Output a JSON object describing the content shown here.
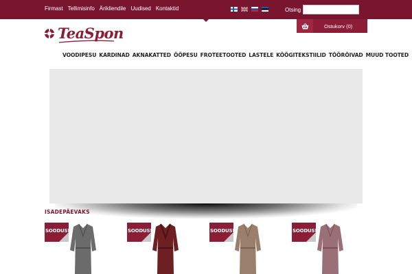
{
  "topbar": {
    "links": [
      "Firmast",
      "Tellimisinfo",
      "Ärikliendile",
      "Uudised",
      "Kontaktid"
    ],
    "languages": [
      {
        "name": "finnish-flag-icon",
        "color": "#2b5aa8"
      },
      {
        "name": "english-flag-icon",
        "color": "#1f3a8a"
      },
      {
        "name": "russian-flag-icon",
        "color": "#c62828"
      },
      {
        "name": "estonian-flag-icon",
        "color": "#1b5fb5"
      }
    ],
    "search_label": "Otsing",
    "search_value": "",
    "search_placeholder": ""
  },
  "cart": {
    "label": "Ostukorv (0)",
    "icon": "basket-icon"
  },
  "logo": {
    "text": "TeaSpon",
    "icon": "lifebuoy-icon",
    "color": "#8c1d36"
  },
  "nav": {
    "items": [
      "VOODIPESU",
      "KARDINAD",
      "AKNAKATTED",
      "ÖÖPESU",
      "FROTEETOOTED",
      "LASTELE",
      "KÖÖGITEKSTIILID",
      "TÖÖRÕIVAD",
      "MUUD TOOTED"
    ]
  },
  "section": {
    "title": "ISADEPÄEVAKS"
  },
  "products": [
    {
      "badge": "SOODUS!",
      "robe_color": "#6b6b6b"
    },
    {
      "badge": "SOODUS!",
      "robe_color": "#6e1f22"
    },
    {
      "badge": "SOODUS!",
      "robe_color": "#9a7f6c"
    },
    {
      "badge": "SOODUS!",
      "robe_color": "#9b6f78"
    }
  ],
  "colors": {
    "brand": "#7a1530",
    "accent": "#8c1d36",
    "banner": "#e8e8e8"
  }
}
